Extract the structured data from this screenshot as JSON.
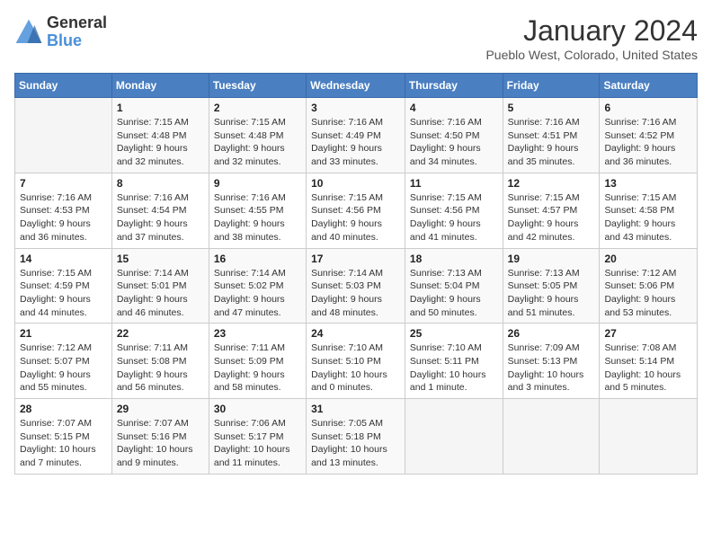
{
  "header": {
    "logo_general": "General",
    "logo_blue": "Blue",
    "month_year": "January 2024",
    "location": "Pueblo West, Colorado, United States"
  },
  "days_of_week": [
    "Sunday",
    "Monday",
    "Tuesday",
    "Wednesday",
    "Thursday",
    "Friday",
    "Saturday"
  ],
  "weeks": [
    [
      {
        "day": "",
        "info": ""
      },
      {
        "day": "1",
        "info": "Sunrise: 7:15 AM\nSunset: 4:48 PM\nDaylight: 9 hours\nand 32 minutes."
      },
      {
        "day": "2",
        "info": "Sunrise: 7:15 AM\nSunset: 4:48 PM\nDaylight: 9 hours\nand 32 minutes."
      },
      {
        "day": "3",
        "info": "Sunrise: 7:16 AM\nSunset: 4:49 PM\nDaylight: 9 hours\nand 33 minutes."
      },
      {
        "day": "4",
        "info": "Sunrise: 7:16 AM\nSunset: 4:50 PM\nDaylight: 9 hours\nand 34 minutes."
      },
      {
        "day": "5",
        "info": "Sunrise: 7:16 AM\nSunset: 4:51 PM\nDaylight: 9 hours\nand 35 minutes."
      },
      {
        "day": "6",
        "info": "Sunrise: 7:16 AM\nSunset: 4:52 PM\nDaylight: 9 hours\nand 36 minutes."
      }
    ],
    [
      {
        "day": "7",
        "info": "Sunrise: 7:16 AM\nSunset: 4:53 PM\nDaylight: 9 hours\nand 36 minutes."
      },
      {
        "day": "8",
        "info": "Sunrise: 7:16 AM\nSunset: 4:54 PM\nDaylight: 9 hours\nand 37 minutes."
      },
      {
        "day": "9",
        "info": "Sunrise: 7:16 AM\nSunset: 4:55 PM\nDaylight: 9 hours\nand 38 minutes."
      },
      {
        "day": "10",
        "info": "Sunrise: 7:15 AM\nSunset: 4:56 PM\nDaylight: 9 hours\nand 40 minutes."
      },
      {
        "day": "11",
        "info": "Sunrise: 7:15 AM\nSunset: 4:56 PM\nDaylight: 9 hours\nand 41 minutes."
      },
      {
        "day": "12",
        "info": "Sunrise: 7:15 AM\nSunset: 4:57 PM\nDaylight: 9 hours\nand 42 minutes."
      },
      {
        "day": "13",
        "info": "Sunrise: 7:15 AM\nSunset: 4:58 PM\nDaylight: 9 hours\nand 43 minutes."
      }
    ],
    [
      {
        "day": "14",
        "info": "Sunrise: 7:15 AM\nSunset: 4:59 PM\nDaylight: 9 hours\nand 44 minutes."
      },
      {
        "day": "15",
        "info": "Sunrise: 7:14 AM\nSunset: 5:01 PM\nDaylight: 9 hours\nand 46 minutes."
      },
      {
        "day": "16",
        "info": "Sunrise: 7:14 AM\nSunset: 5:02 PM\nDaylight: 9 hours\nand 47 minutes."
      },
      {
        "day": "17",
        "info": "Sunrise: 7:14 AM\nSunset: 5:03 PM\nDaylight: 9 hours\nand 48 minutes."
      },
      {
        "day": "18",
        "info": "Sunrise: 7:13 AM\nSunset: 5:04 PM\nDaylight: 9 hours\nand 50 minutes."
      },
      {
        "day": "19",
        "info": "Sunrise: 7:13 AM\nSunset: 5:05 PM\nDaylight: 9 hours\nand 51 minutes."
      },
      {
        "day": "20",
        "info": "Sunrise: 7:12 AM\nSunset: 5:06 PM\nDaylight: 9 hours\nand 53 minutes."
      }
    ],
    [
      {
        "day": "21",
        "info": "Sunrise: 7:12 AM\nSunset: 5:07 PM\nDaylight: 9 hours\nand 55 minutes."
      },
      {
        "day": "22",
        "info": "Sunrise: 7:11 AM\nSunset: 5:08 PM\nDaylight: 9 hours\nand 56 minutes."
      },
      {
        "day": "23",
        "info": "Sunrise: 7:11 AM\nSunset: 5:09 PM\nDaylight: 9 hours\nand 58 minutes."
      },
      {
        "day": "24",
        "info": "Sunrise: 7:10 AM\nSunset: 5:10 PM\nDaylight: 10 hours\nand 0 minutes."
      },
      {
        "day": "25",
        "info": "Sunrise: 7:10 AM\nSunset: 5:11 PM\nDaylight: 10 hours\nand 1 minute."
      },
      {
        "day": "26",
        "info": "Sunrise: 7:09 AM\nSunset: 5:13 PM\nDaylight: 10 hours\nand 3 minutes."
      },
      {
        "day": "27",
        "info": "Sunrise: 7:08 AM\nSunset: 5:14 PM\nDaylight: 10 hours\nand 5 minutes."
      }
    ],
    [
      {
        "day": "28",
        "info": "Sunrise: 7:07 AM\nSunset: 5:15 PM\nDaylight: 10 hours\nand 7 minutes."
      },
      {
        "day": "29",
        "info": "Sunrise: 7:07 AM\nSunset: 5:16 PM\nDaylight: 10 hours\nand 9 minutes."
      },
      {
        "day": "30",
        "info": "Sunrise: 7:06 AM\nSunset: 5:17 PM\nDaylight: 10 hours\nand 11 minutes."
      },
      {
        "day": "31",
        "info": "Sunrise: 7:05 AM\nSunset: 5:18 PM\nDaylight: 10 hours\nand 13 minutes."
      },
      {
        "day": "",
        "info": ""
      },
      {
        "day": "",
        "info": ""
      },
      {
        "day": "",
        "info": ""
      }
    ]
  ]
}
